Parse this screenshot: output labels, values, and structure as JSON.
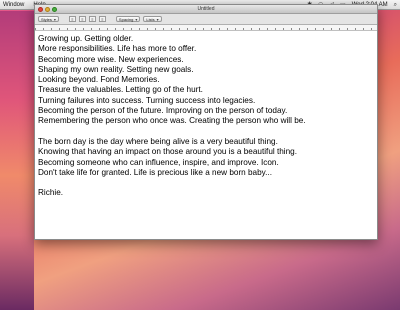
{
  "menubar": {
    "items": [
      "Window",
      "Help"
    ],
    "clock": "Wed 2:04 AM"
  },
  "window": {
    "title": "Untitled"
  },
  "toolbar": {
    "styles_label": "Styles",
    "spacing_label": "Spacing",
    "lists_label": "Lists"
  },
  "document": {
    "paragraph1": [
      "Growing up. Getting older.",
      "More responsibilities. Life has more to offer.",
      "Becoming more wise. New experiences.",
      "Shaping my own reality. Setting new goals.",
      "Looking beyond. Fond Memories.",
      "Treasure the valuables. Letting go of the hurt.",
      "Turning failures into success. Turning success into legacies.",
      "Becoming the person of the future. Improving on the person of today.",
      "Remembering the person who once was. Creating the person who will be."
    ],
    "paragraph2": [
      "The born day is the day where being alive is a very beautiful thing.",
      "Knowing that having an impact on those around you is a beautiful thing.",
      "Becoming someone who can influence, inspire, and improve. Icon.",
      "Don't take life for granted. Life is precious like a new born baby..."
    ],
    "signature": "Richie."
  },
  "colors": {
    "desktop_accent": "#e85a8a",
    "close": "#e0443e",
    "minimize": "#e0b03a",
    "zoom": "#4ab040"
  }
}
